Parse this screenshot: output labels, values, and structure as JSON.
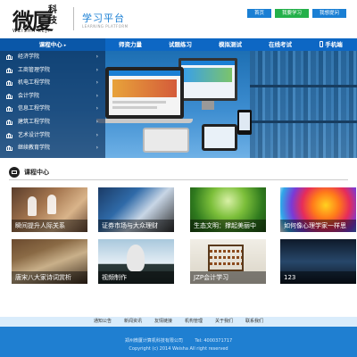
{
  "header": {
    "logo_main": "微厦",
    "logo_side": "科技",
    "logo_sub": "WEISHA KEJI",
    "brand_title": "学习平台",
    "brand_sub": "LEARNING PLATFORM",
    "buttons": {
      "home": "首页",
      "study": "我要学习",
      "suggest": "我想提问"
    }
  },
  "nav": {
    "items": [
      {
        "label": "课程中心",
        "active": true
      },
      {
        "label": "师资力量"
      },
      {
        "label": "试题练习"
      },
      {
        "label": "模拟测试"
      },
      {
        "label": "在线考试"
      },
      {
        "label": "手机端"
      }
    ],
    "arrow": "▸",
    "phone_icon": "phone-icon"
  },
  "sidebar": {
    "items": [
      {
        "label": "经济学院",
        "arrow": "›"
      },
      {
        "label": "工商管理学院",
        "arrow": "›"
      },
      {
        "label": "机电工程学院",
        "arrow": "›"
      },
      {
        "label": "会计学院",
        "arrow": "›"
      },
      {
        "label": "信息工程学院",
        "arrow": "›"
      },
      {
        "label": "建筑工程学院",
        "arrow": "›"
      },
      {
        "label": "艺术设计学院",
        "arrow": "›"
      },
      {
        "label": "继续教育学院",
        "arrow": "›"
      }
    ]
  },
  "section": {
    "title": "课程中心"
  },
  "courses": [
    {
      "caption": "瞬间提升人际关系"
    },
    {
      "caption": "证券市场与大众理财"
    },
    {
      "caption": "生态文明：撑起美丽中"
    },
    {
      "caption": "如何像心理学家一样思"
    },
    {
      "caption": "唐宋八大家诗词赏析"
    },
    {
      "caption": "视频制作"
    },
    {
      "caption": "JZP会计学习"
    },
    {
      "caption": "123"
    }
  ],
  "footer": {
    "links": [
      "通知公告",
      "新闻资讯",
      "友情链接",
      "机构管理",
      "关于我们",
      "联系我们"
    ],
    "company": "郑州微厦计算机科技有限公司",
    "tel": "Tel: 4000371717",
    "copyright": "Copyright (c) 2014 Weisha All right reserved"
  },
  "colors": {
    "primary": "#1a7fd4",
    "nav": "#0d67c4",
    "green_button": "#24b04a",
    "footer": "#1f7fd1"
  }
}
